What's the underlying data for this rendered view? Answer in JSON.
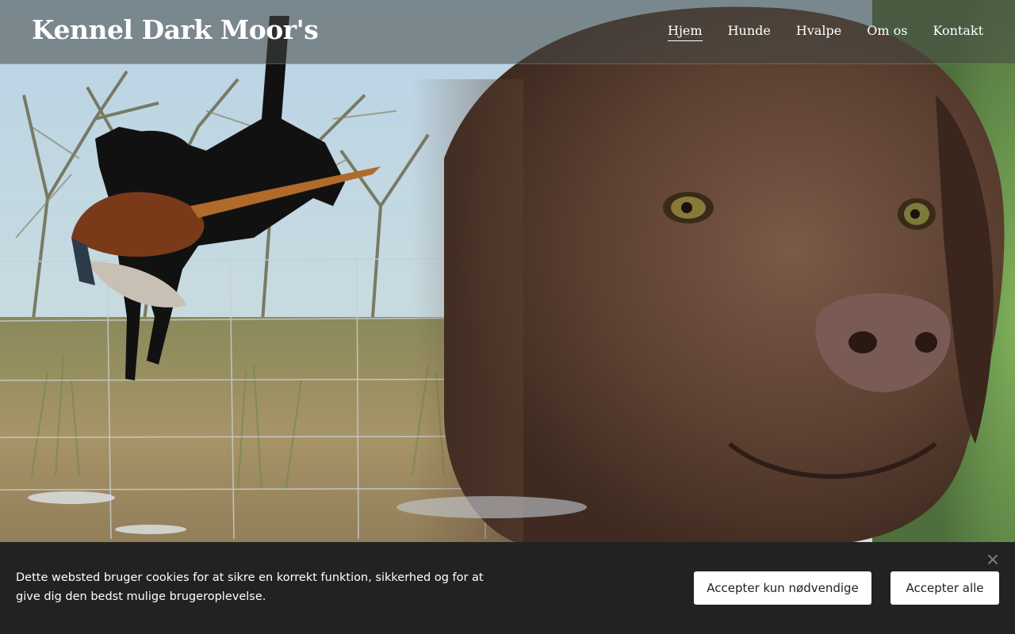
{
  "header": {
    "site_title": "Kennel Dark Moor's",
    "nav": [
      {
        "label": "Hjem",
        "active": true
      },
      {
        "label": "Hunde",
        "active": false
      },
      {
        "label": "Hvalpe",
        "active": false
      },
      {
        "label": "Om os",
        "active": false
      },
      {
        "label": "Kontakt",
        "active": false
      }
    ]
  },
  "hero": {
    "image_subject": "black labrador retrieving pheasant over fence, chocolate labrador portrait"
  },
  "cookie_banner": {
    "text": "Dette websted bruger cookies for at sikre en korrekt funktion, sikkerhed og for at give dig den bedst mulige brugeroplevelse.",
    "accept_necessary_label": "Accepter kun nødvendige",
    "accept_all_label": "Accepter alle",
    "close_icon": "close-icon"
  },
  "colors": {
    "cookie_bg": "#222222",
    "button_bg": "#ffffff",
    "nav_text": "#ffffff"
  }
}
